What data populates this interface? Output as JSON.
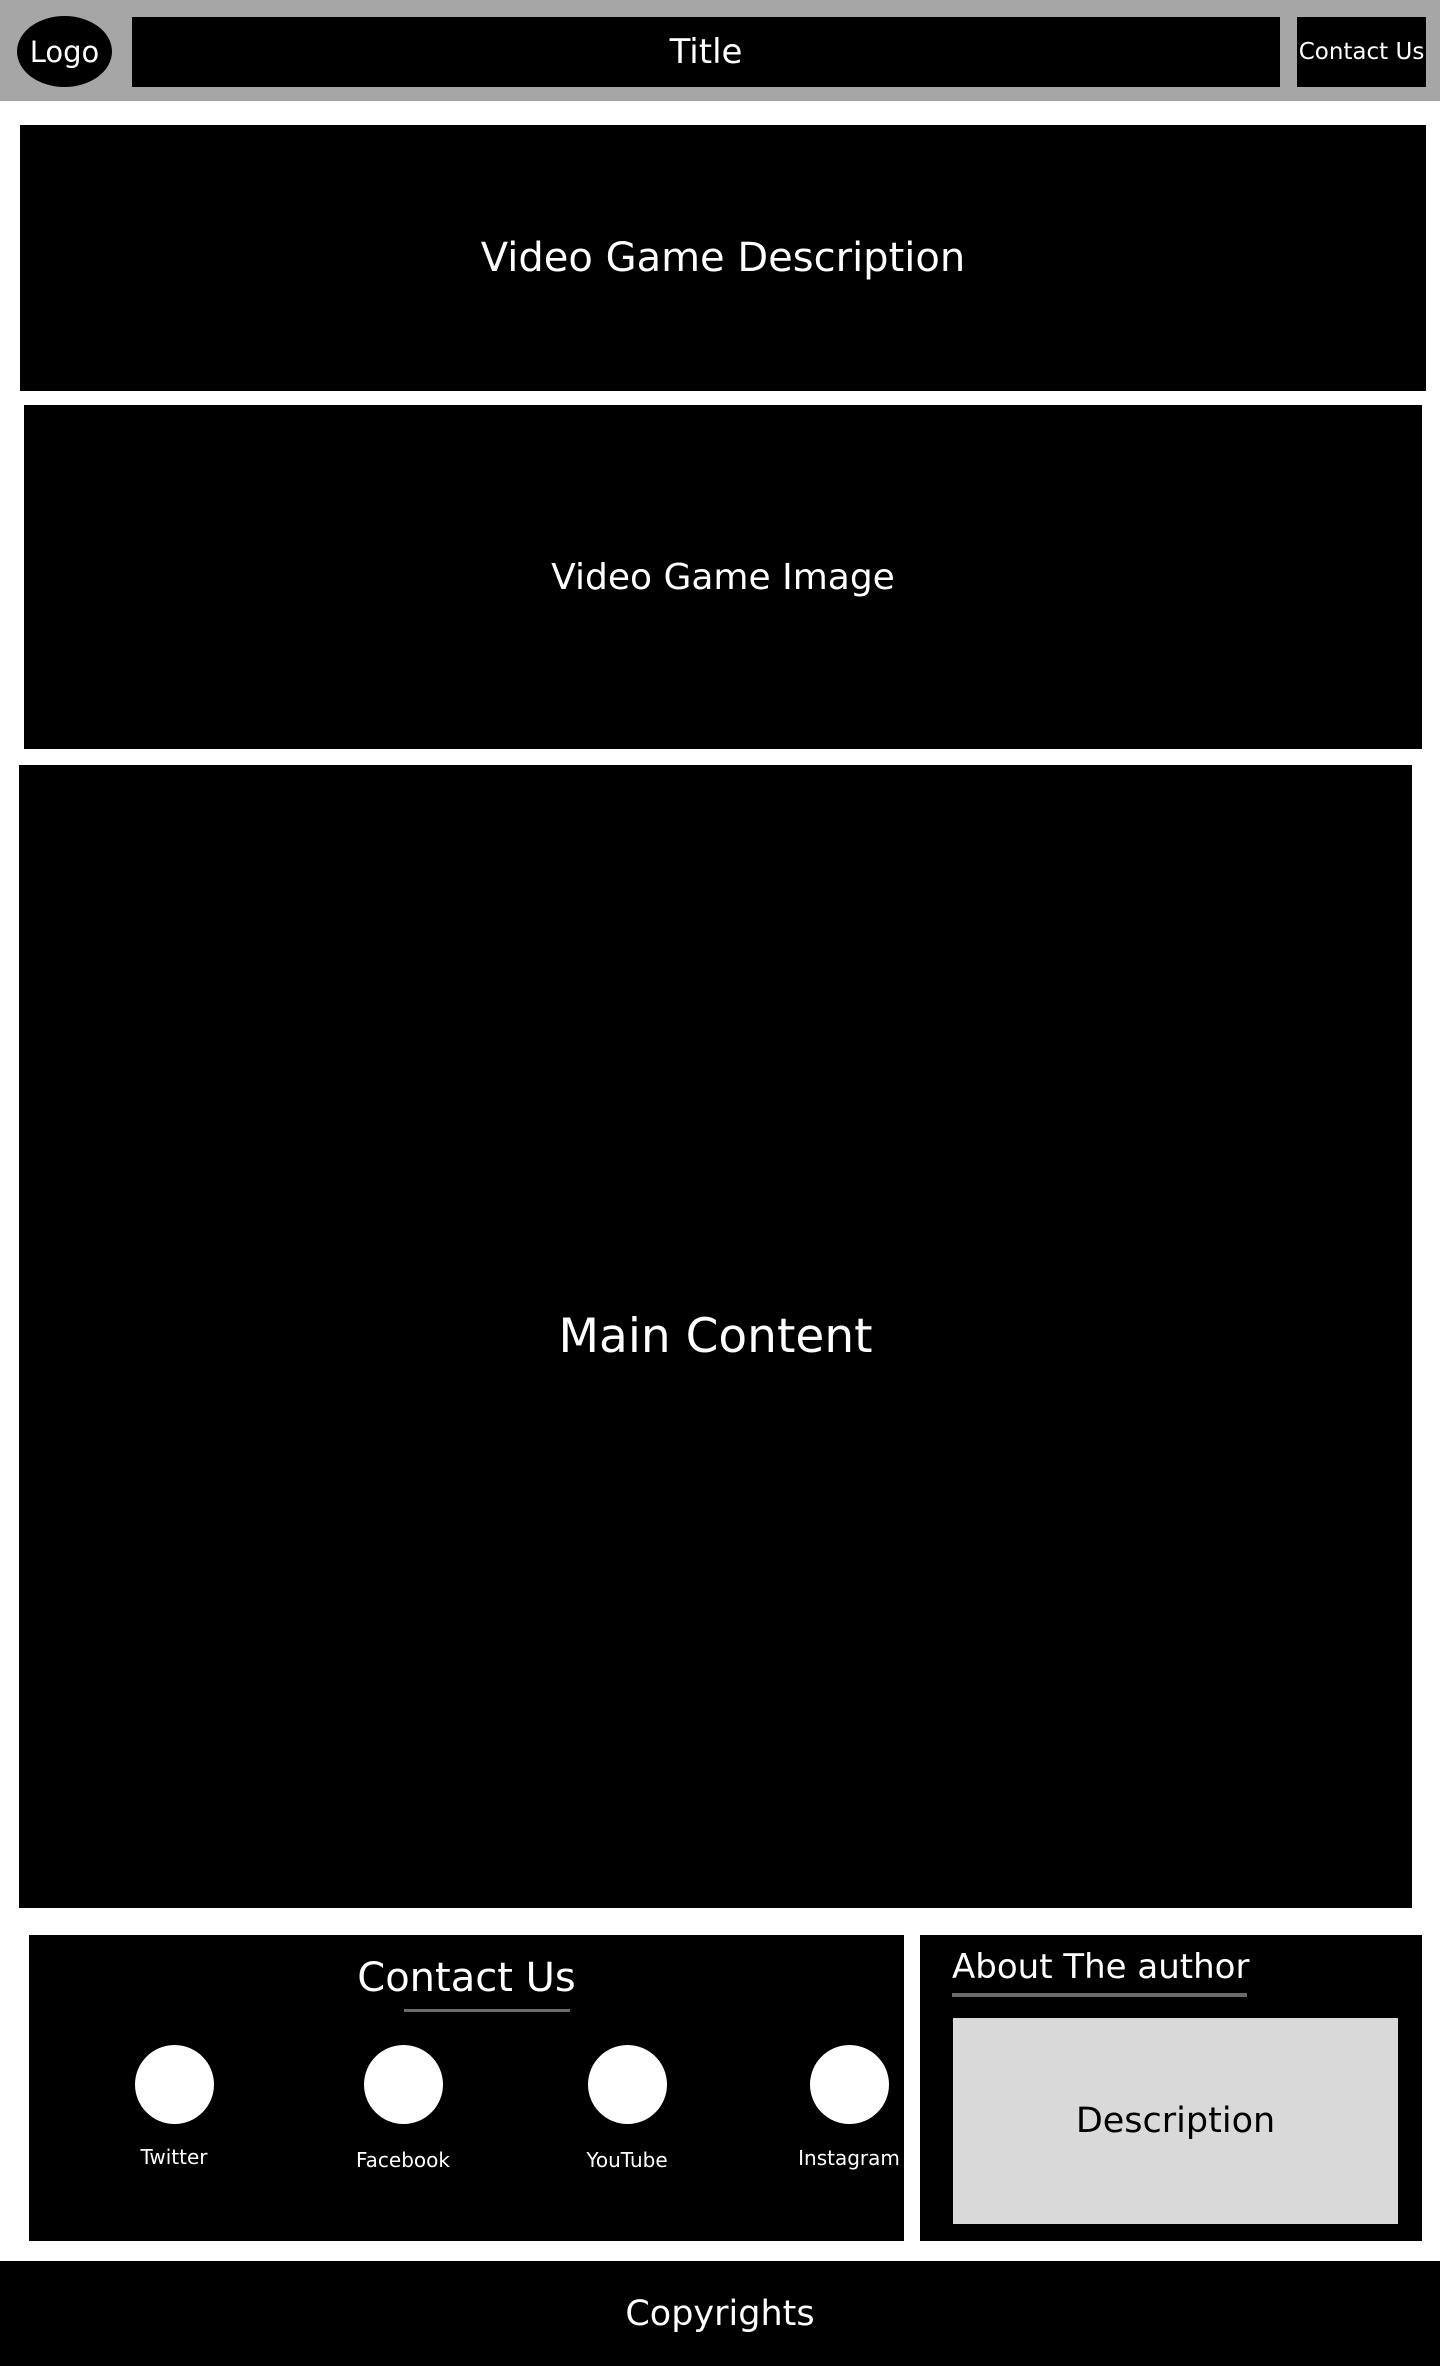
{
  "header": {
    "logo": "Logo",
    "title": "Title",
    "contact_button": "Contact Us"
  },
  "sections": {
    "description": "Video Game Description",
    "image": "Video Game Image",
    "main": "Main Content"
  },
  "contact": {
    "heading": "Contact Us",
    "links": [
      {
        "label": "Twitter",
        "icon": "twitter-icon"
      },
      {
        "label": "Facebook",
        "icon": "facebook-icon"
      },
      {
        "label": "YouTube",
        "icon": "youtube-icon"
      },
      {
        "label": "Instagram",
        "icon": "instagram-icon"
      }
    ]
  },
  "about": {
    "heading": "About The author",
    "description": "Description"
  },
  "footer": {
    "text": "Copyrights"
  },
  "colors": {
    "header_bg": "#a6a6a6",
    "block_bg": "#000000",
    "description_bg": "#d9d9d9",
    "underline": "#6b6b6b"
  }
}
